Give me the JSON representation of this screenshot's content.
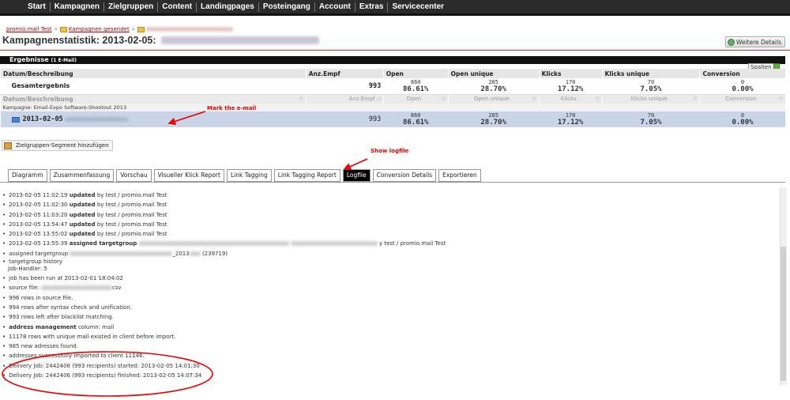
{
  "nav": [
    "Start",
    "Kampagnen",
    "Zielgruppen",
    "Content",
    "Landingpages",
    "Posteingang",
    "Account",
    "Extras",
    "Servicecenter"
  ],
  "breadcrumb": {
    "root": "promio.mail Test",
    "sep": "»",
    "folder1": "Kampagnen gesendet"
  },
  "page_title": "Kampagnenstatistik: 2013-02-05:",
  "details_button": "Weitere Details",
  "results": {
    "header": "Ergebnisse",
    "header_count": "(1 E-Mail)",
    "spalten": "Spalten",
    "columns": [
      "Datum/Beschreibung",
      "Anz.Empf",
      "Open",
      "Open unique",
      "Klicks",
      "Klicks unique",
      "Conversion"
    ],
    "total": {
      "label": "Gesamtergebnis",
      "empf": "993",
      "open": "860",
      "open_pct": "86.61%",
      "open_u": "285",
      "open_u_pct": "28.70%",
      "klicks": "170",
      "klicks_pct": "17.12%",
      "klicks_u": "70",
      "klicks_u_pct": "7.05%",
      "conv": "0",
      "conv_pct": "0.00%"
    },
    "campaign": "Kampagne: Email-Expo Software-Shootout 2013",
    "row": {
      "date": "2013-02-05",
      "empf": "993",
      "open": "860",
      "open_pct": "86.61%",
      "open_u": "285",
      "open_u_pct": "28.70%",
      "klicks": "170",
      "klicks_pct": "17.12%",
      "klicks_u": "70",
      "klicks_u_pct": "7.05%",
      "conv": "0",
      "conv_pct": "0.00%"
    }
  },
  "zielgruppen_button": "Zielgruppen-Segment hinzufügen",
  "annotations": {
    "mark": "Mark the e-mail",
    "logfile": "Show  logfile"
  },
  "tabs": [
    "Diagramm",
    "Zusammenfassung",
    "Vorschau",
    "Visueller Klick Report",
    "Link Tagging",
    "Link Tagging Report",
    "Logfile",
    "Conversion Details",
    "Exportieren"
  ],
  "log": {
    "l1_time": "2013-02-05 11:02:19",
    "l2_time": "2013-02-05 11:02:30",
    "l3_time": "2013-02-05 11:03:20",
    "l4_time": "2013-02-05 13:54:47",
    "l5_time": "2013-02-05 13:55:02",
    "updated": "updated",
    "by": "by test / promio.mail Test",
    "l6_time": "2013-02-05 13:55:39",
    "assigned": "assigned targetgroup",
    "l6_tail": "y test / promio.mail Test",
    "l7_a": "assigned targetgroup",
    "l7_b": "_2013",
    "l7_c": "(239719)",
    "l8_a": "targetgroup history",
    "l8_b": "Job-Handler: 5",
    "l9": "job has been run at 2013-02-01 18:04:02",
    "l10_a": "source file:",
    "l10_b": "csv",
    "l11": "996 rows in source file.",
    "l12": "994 rows after syntax check and unification.",
    "l13": "993 rows left after blacklist matching.",
    "l14_a": "address management",
    "l14_b": "column: mail",
    "l15": "11178 rows with unique mail existed in client before import.",
    "l16": "985 new adresses found.",
    "l17": "addresses successfully imported to client 11146.",
    "l18": "Delivery Job: 2442406 (993 recipients) started: 2013-02-05 14:01:30",
    "l19": "Delivery Job: 2442406 (993 recipients) finished: 2013-02-05 14:07:34"
  }
}
